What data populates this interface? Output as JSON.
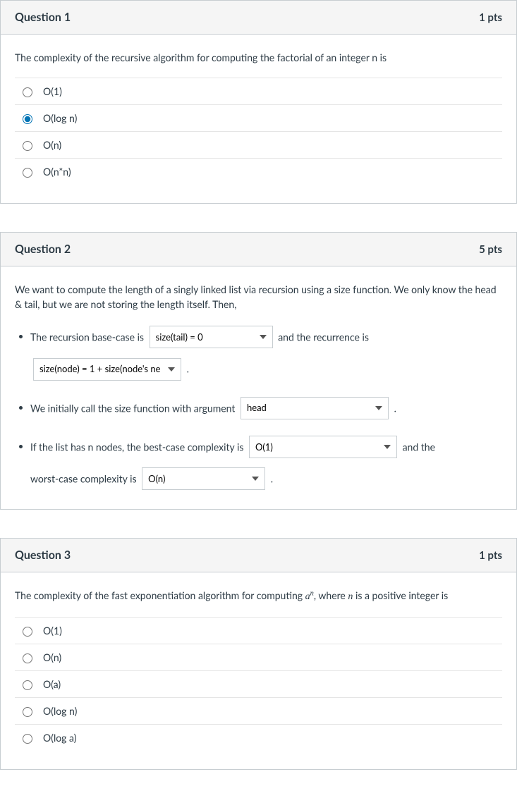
{
  "q1": {
    "title": "Question 1",
    "pts": "1 pts",
    "prompt": "The complexity of the recursive algorithm for computing the factorial of an integer n is",
    "options": [
      "O(1)",
      "O(log n)",
      "O(n)",
      "O(n*n)"
    ],
    "selected_index": 1
  },
  "q2": {
    "title": "Question 2",
    "pts": "5 pts",
    "prompt": "We want to compute the length of a singly linked list via recursion using a size function. We only know the head & tail, but we are not storing the length itself. Then,",
    "li1_a": "The recursion base-case is",
    "sel1": "size(tail) = 0",
    "li1_b": "and the recurrence is",
    "sel2": "size(node) = 1 + size(node's ne",
    "li1_c": ".",
    "li2_a": "We initially call the size function with argument",
    "sel3": "head",
    "li2_b": ".",
    "li3_a": "If the list has n nodes, the best-case complexity is",
    "sel4": "O(1)",
    "li3_b": "and the worst-case complexity is",
    "li3_b_part1": "and the",
    "li3_b_part2": "worst-case complexity is",
    "sel5": "O(n)",
    "li3_c": "."
  },
  "q3": {
    "title": "Question 3",
    "pts": "1 pts",
    "prompt_a": "The complexity of the fast exponentiation algorithm for computing ",
    "prompt_b": ", where ",
    "prompt_c": " is a positive integer is",
    "options": [
      "O(1)",
      "O(n)",
      "O(a)",
      "O(log n)",
      "O(log a)"
    ],
    "selected_index": -1
  }
}
